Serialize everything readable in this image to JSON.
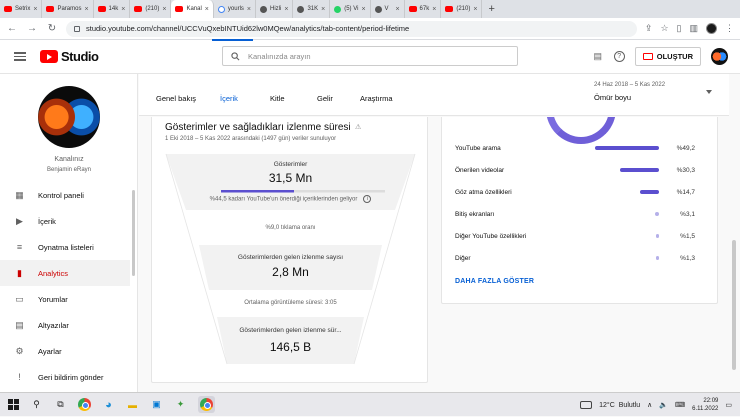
{
  "browser": {
    "tabs": [
      {
        "label": "Setrix",
        "icon": "yt"
      },
      {
        "label": "Paramos",
        "icon": "yt"
      },
      {
        "label": "14k",
        "icon": "yt"
      },
      {
        "label": "(210)",
        "icon": "yt"
      },
      {
        "label": "Kanal",
        "icon": "yt",
        "active": true
      },
      {
        "label": "yourls",
        "icon": "g"
      },
      {
        "label": "Hizli",
        "icon": "o"
      },
      {
        "label": "31K",
        "icon": "o"
      },
      {
        "label": "(5) Vi",
        "icon": "w"
      },
      {
        "label": "V",
        "icon": "o"
      },
      {
        "label": "67k",
        "icon": "yt"
      },
      {
        "label": "(210)",
        "icon": "yt"
      }
    ],
    "url": "studio.youtube.com/channel/UCCVuQxebINTUid62lw0MQew/analytics/tab-content/period-lifetime"
  },
  "header": {
    "logo_text": "Studio",
    "search_placeholder": "Kanalınızda arayın",
    "create_label": "OLUŞTUR"
  },
  "sidebar": {
    "channel_label": "Kanalınız",
    "channel_name": "Benjamin eRayn",
    "items": [
      {
        "label": "Kontrol paneli",
        "icon": "dashboard-icon",
        "glyph": "▦"
      },
      {
        "label": "İçerik",
        "icon": "content-icon",
        "glyph": "▶"
      },
      {
        "label": "Oynatma listeleri",
        "icon": "playlist-icon",
        "glyph": "≡"
      },
      {
        "label": "Analytics",
        "icon": "analytics-icon",
        "glyph": "▮",
        "active": true
      },
      {
        "label": "Yorumlar",
        "icon": "comments-icon",
        "glyph": "▭"
      },
      {
        "label": "Altyazılar",
        "icon": "subtitles-icon",
        "glyph": "▤"
      }
    ],
    "bottom_items": [
      {
        "label": "Ayarlar",
        "icon": "settings-icon",
        "glyph": "⚙"
      },
      {
        "label": "Geri bildirim gönder",
        "icon": "feedback-icon",
        "glyph": "!"
      }
    ]
  },
  "content_tabs": [
    "Genel bakış",
    "İçerik",
    "Kitle",
    "Gelir",
    "Araştırma"
  ],
  "active_tab": "İçerik",
  "date_filter": {
    "range": "24 Haz 2018 – 5 Kas 2022",
    "mode": "Ömür boyu"
  },
  "funnel": {
    "title": "Gösterimler ve sağladıkları izlenme süresi",
    "subtitle": "1 Eki 2018 – 5 Kas 2022 arasındaki (1497 gün) veriler sunuluyor",
    "impressions_label": "Gösterimler",
    "impressions_value": "31,5 Mn",
    "impressions_bar_fraction": 0.445,
    "impressions_note": "%44,5 kadarı YouTube'un önerdiği içeriklerinden geliyor",
    "ctr_label": "%9,0 tıklama oranı",
    "views_label": "Gösterimlerden gelen izlenme sayısı",
    "views_value": "2,8 Mn",
    "avg_duration_label": "Ortalama görüntüleme süresi: 3:05",
    "watch_time_label": "Gösterimlerden gelen izlenme sür...",
    "watch_time_value": "146,5 B"
  },
  "traffic_sources": {
    "rows": [
      {
        "name": "YouTube arama",
        "pct": "%49,2",
        "value": 49.2
      },
      {
        "name": "Önerilen videolar",
        "pct": "%30,3",
        "value": 30.3
      },
      {
        "name": "Göz atma özellikleri",
        "pct": "%14,7",
        "value": 14.7
      },
      {
        "name": "Bitiş ekranları",
        "pct": "%3,1",
        "value": 3.1
      },
      {
        "name": "Diğer YouTube özellikleri",
        "pct": "%1,5",
        "value": 1.5
      },
      {
        "name": "Diğer",
        "pct": "%1,3",
        "value": 1.3
      }
    ],
    "more_label": "DAHA FAZLA GÖSTER",
    "bar_color": "#5b4fcf"
  },
  "taskbar": {
    "temperature": "12°C",
    "weather": "Bulutlu",
    "time": "22:09",
    "date": "6.11.2022"
  }
}
